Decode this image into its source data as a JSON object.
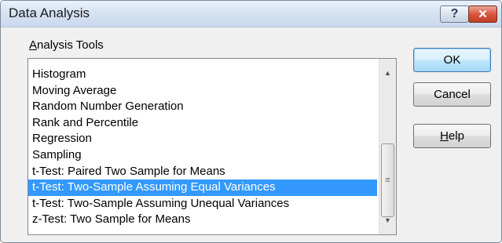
{
  "window": {
    "title": "Data Analysis",
    "help_glyph": "?",
    "close_glyph": "✕"
  },
  "tools_label": {
    "mnemonic": "A",
    "rest": "nalysis Tools"
  },
  "list": {
    "items": [
      "Histogram",
      "Moving Average",
      "Random Number Generation",
      "Rank and Percentile",
      "Regression",
      "Sampling",
      "t-Test: Paired Two Sample for Means",
      "t-Test: Two-Sample Assuming Equal Variances",
      "t-Test: Two-Sample Assuming Unequal Variances",
      "z-Test: Two Sample for Means"
    ],
    "selected_index": 7
  },
  "buttons": {
    "ok": "OK",
    "cancel": "Cancel",
    "help_mnemonic": "H",
    "help_rest": "elp"
  },
  "icons": {
    "scroll_up": "up-arrow-icon",
    "scroll_down": "down-arrow-icon",
    "grip": "scroll-grip-icon"
  },
  "colors": {
    "selection": "#3399ff",
    "close_button": "#d9573f"
  }
}
